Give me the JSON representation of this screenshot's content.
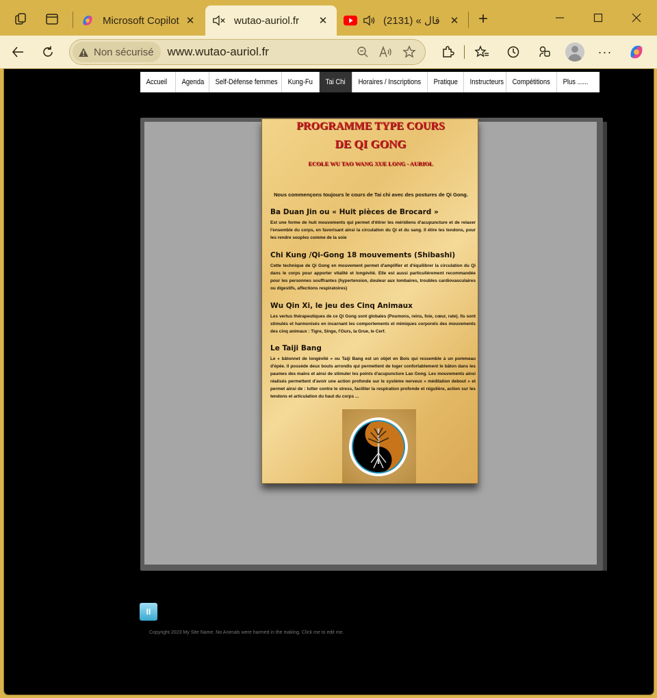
{
  "browser": {
    "tabs": [
      {
        "title": "Microsoft Copilot",
        "favicon": "copilot-icon"
      },
      {
        "title": "wutao-auriol.fr",
        "favicon": "muted-speaker-icon",
        "active": true
      },
      {
        "title": "(2131) « قال",
        "favicon": "youtube-icon",
        "audio": "speaker-icon"
      }
    ],
    "address": {
      "security_label": "Non sécurisé",
      "url": "www.wutao-auriol.fr"
    },
    "colors": {
      "frame": "#d9b44a",
      "toolbar": "#f7efcf"
    }
  },
  "site": {
    "nav": [
      {
        "label": "Accueil"
      },
      {
        "label": "Agenda"
      },
      {
        "label": "Self-Défense femmes"
      },
      {
        "label": "Kung-Fu"
      },
      {
        "label": "Tai Chi",
        "active": true
      },
      {
        "label": "Horaires / Inscriptions"
      },
      {
        "label": "Pratique"
      },
      {
        "label": "Instructeurs"
      },
      {
        "label": "Compétitions"
      },
      {
        "label": "Plus ......"
      }
    ],
    "poster": {
      "title_line1": "PROGRAMME TYPE COURS",
      "title_line2": "DE QI GONG",
      "school": "ECOLE WU TAO WANG XUE LONG - AURIOL",
      "intro": "Nous commençons toujours le cours de Tai chi  avec des postures de Qi Gong.",
      "sections": [
        {
          "heading": "Ba Duan Jin ou « Huit pièces de Brocard »",
          "body": "Est une forme de huit mouvements qui permet d'étirer les méridiens d'acupuncture et de relaxer l'ensemble du corps, en favorisant ainsi la circulation du Qi et du sang. Il étire les tendons, pour les rendre souples comme de la soie"
        },
        {
          "heading": "Chi Kung /Qi-Gong 18 mouvements (Shibashi)",
          "body": "Cette technique de Qi Gong en mouvement permet d'amplifier et d'équilibrer la circulation du Qi dans le corps pour apporter vitalité et longévité. Elle est aussi particulièrement recommandée pour les personnes souffrantes (hypertension, douleur aux lombaires, troubles cardiovasculaires ou digestifs, affections respiratoires)"
        },
        {
          "heading": "Wu Qin Xi, le jeu des Cinq Animaux",
          "body": "Les vertus thérapeutiques de ce Qi Gong sont globales (Poumons, reins, foie, cœur, rate). Ils  sont stimulés et harmonisés en incarnant les comportements et mimiques corporels des mouvements des cinq animaux : Tigre, Singe, l'Ours, la Grue, le Cerf."
        },
        {
          "heading": "Le Taiji Bang",
          "body": "Le « bâtonnet de longévité » ou Taiji Bang est un objet en Bois qui ressemble à un pommeau d'épée. Il possède deux bouts arrondis qui permettent de loger confortablement le bâton dans les paumes des mains et ainsi de stimuler les points d'acupuncture Lao Gong. Les mouvements ainsi réalisés permettent d'avoir une action profonde sur le système nerveux « méditation debout » et permet ainsi de : lutter contre le stress, faciliter la respiration profonde et régulière, action sur les tendons et articulation du haut du corps ..."
        }
      ]
    },
    "play_button": {
      "icon": "pause-icon",
      "label": "II"
    },
    "footer": "Copyright 2023 My Site Name. No Animals were harmed in the making. Click me to edit me."
  }
}
